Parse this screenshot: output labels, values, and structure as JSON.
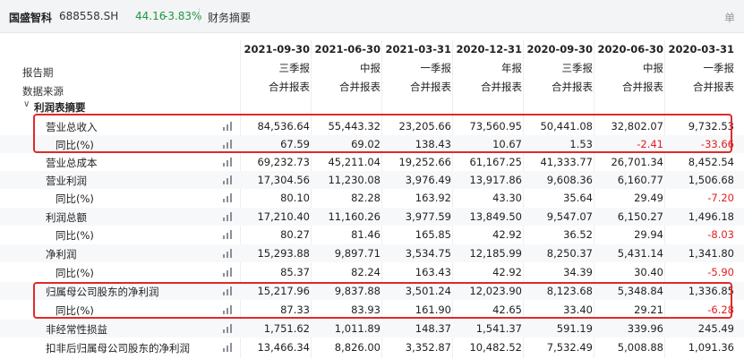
{
  "header": {
    "stock_name": "国盛智科",
    "stock_code": "688558.SH",
    "price": "44.16",
    "change_pct": "-3.83%",
    "tab": "财务摘要",
    "corner": "单"
  },
  "left_headers": {
    "period": "报告期",
    "source": "数据来源"
  },
  "columns": [
    {
      "date": "2021-09-30",
      "type": "三季报",
      "source": "合并报表"
    },
    {
      "date": "2021-06-30",
      "type": "中报",
      "source": "合并报表"
    },
    {
      "date": "2021-03-31",
      "type": "一季报",
      "source": "合并报表"
    },
    {
      "date": "2020-12-31",
      "type": "年报",
      "source": "合并报表"
    },
    {
      "date": "2020-09-30",
      "type": "三季报",
      "source": "合并报表"
    },
    {
      "date": "2020-06-30",
      "type": "中报",
      "source": "合并报表"
    },
    {
      "date": "2020-03-31",
      "type": "一季报",
      "source": "合并报表"
    }
  ],
  "section": {
    "label": "利润表摘要",
    "arrow": "∨"
  },
  "rows": [
    {
      "label": "营业总收入",
      "indent": 1,
      "values": [
        "84,536.64",
        "55,443.32",
        "23,205.66",
        "73,560.95",
        "50,441.08",
        "32,802.07",
        "9,732.53"
      ]
    },
    {
      "label": "同比(%)",
      "indent": 2,
      "values": [
        "67.59",
        "69.02",
        "138.43",
        "10.67",
        "1.53",
        "-2.41",
        "-33.66"
      ]
    },
    {
      "label": "营业总成本",
      "indent": 1,
      "values": [
        "69,232.73",
        "45,211.04",
        "19,252.66",
        "61,167.25",
        "41,333.77",
        "26,701.34",
        "8,452.54"
      ]
    },
    {
      "label": "营业利润",
      "indent": 1,
      "values": [
        "17,304.56",
        "11,230.08",
        "3,976.49",
        "13,917.86",
        "9,608.36",
        "6,160.77",
        "1,506.68"
      ]
    },
    {
      "label": "同比(%)",
      "indent": 2,
      "values": [
        "80.10",
        "82.28",
        "163.92",
        "43.30",
        "35.64",
        "29.49",
        "-7.20"
      ]
    },
    {
      "label": "利润总额",
      "indent": 1,
      "values": [
        "17,210.40",
        "11,160.26",
        "3,977.59",
        "13,849.50",
        "9,547.07",
        "6,150.27",
        "1,496.18"
      ]
    },
    {
      "label": "同比(%)",
      "indent": 2,
      "values": [
        "80.27",
        "81.46",
        "165.85",
        "42.92",
        "36.52",
        "29.94",
        "-8.03"
      ]
    },
    {
      "label": "净利润",
      "indent": 1,
      "values": [
        "15,293.88",
        "9,897.71",
        "3,534.75",
        "12,185.99",
        "8,250.37",
        "5,431.14",
        "1,341.80"
      ]
    },
    {
      "label": "同比(%)",
      "indent": 2,
      "values": [
        "85.37",
        "82.24",
        "163.43",
        "42.92",
        "34.39",
        "30.40",
        "-5.90"
      ]
    },
    {
      "label": "归属母公司股东的净利润",
      "indent": 1,
      "values": [
        "15,217.96",
        "9,837.88",
        "3,501.24",
        "12,023.90",
        "8,123.68",
        "5,348.84",
        "1,336.85"
      ]
    },
    {
      "label": "同比(%)",
      "indent": 2,
      "values": [
        "87.33",
        "83.93",
        "161.90",
        "42.65",
        "33.40",
        "29.21",
        "-6.28"
      ]
    },
    {
      "label": "非经常性损益",
      "indent": 1,
      "values": [
        "1,751.62",
        "1,011.89",
        "148.37",
        "1,541.37",
        "591.19",
        "339.96",
        "245.49"
      ]
    },
    {
      "label": "扣非后归属母公司股东的净利润",
      "indent": 1,
      "values": [
        "13,466.34",
        "8,826.00",
        "3,352.87",
        "10,482.52",
        "7,532.49",
        "5,008.88",
        "1,091.36"
      ]
    }
  ],
  "colors": {
    "negative": "#e02020",
    "highlight": "#e02a2a",
    "up_green": "#1a9a3a"
  }
}
